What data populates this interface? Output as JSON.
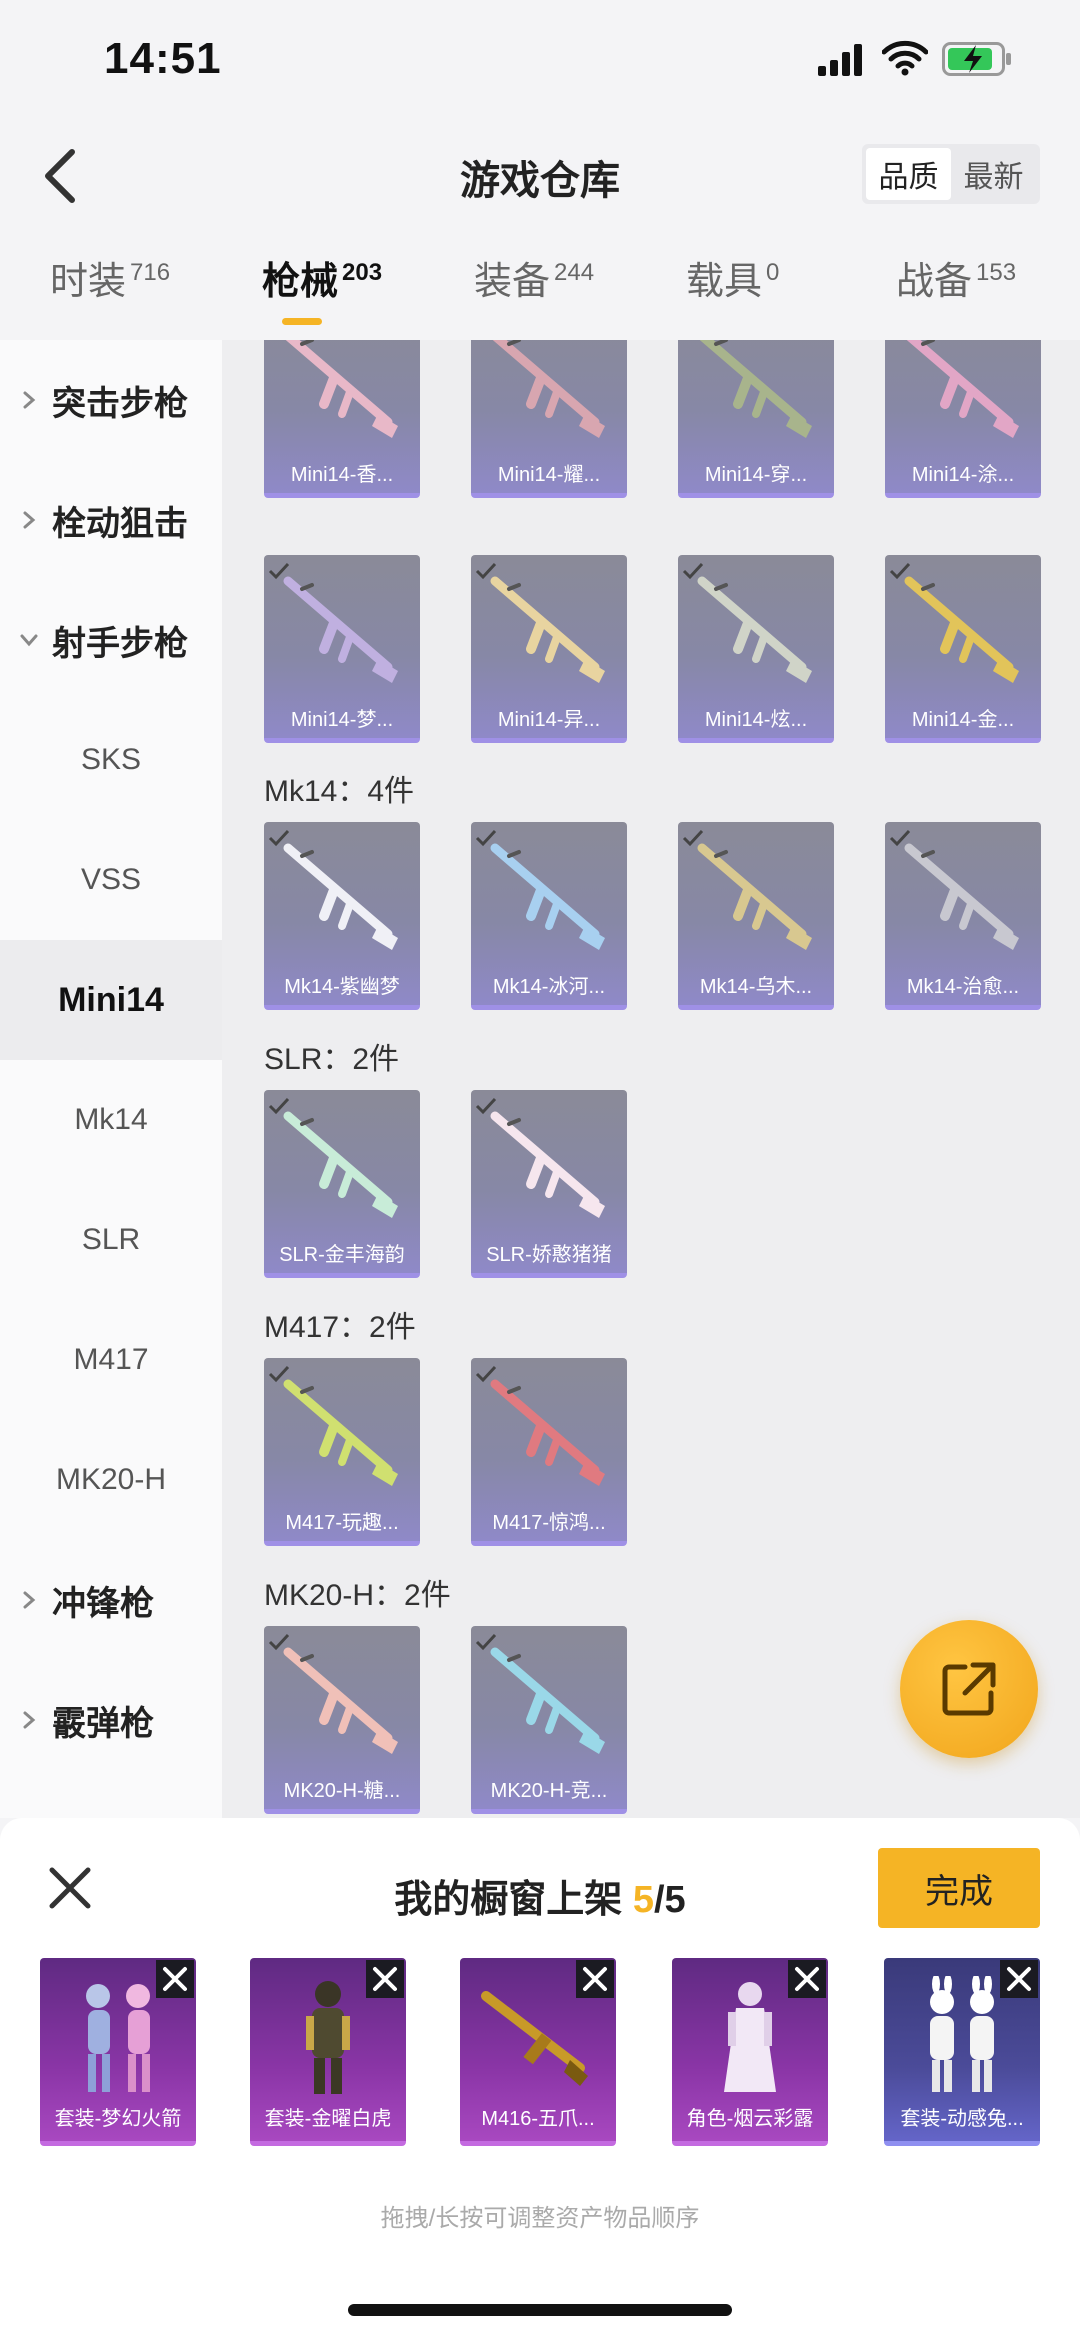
{
  "status": {
    "time": "14:51"
  },
  "header": {
    "title": "游戏仓库",
    "sort_options": [
      "品质",
      "最新"
    ]
  },
  "tabs": [
    {
      "label": "时装",
      "count": "716"
    },
    {
      "label": "枪械",
      "count": "203",
      "active": true
    },
    {
      "label": "装备",
      "count": "244"
    },
    {
      "label": "载具",
      "count": "0"
    },
    {
      "label": "战备",
      "count": "153"
    }
  ],
  "sidebar": {
    "items": [
      {
        "label": "突击步枪",
        "kind": "group"
      },
      {
        "label": "栓动狙击",
        "kind": "group"
      },
      {
        "label": "射手步枪",
        "kind": "group",
        "expanded": true
      },
      {
        "label": "SKS",
        "kind": "sub"
      },
      {
        "label": "VSS",
        "kind": "sub"
      },
      {
        "label": "Mini14",
        "kind": "sub",
        "selected": true
      },
      {
        "label": "Mk14",
        "kind": "sub"
      },
      {
        "label": "SLR",
        "kind": "sub"
      },
      {
        "label": "M417",
        "kind": "sub"
      },
      {
        "label": "MK20-H",
        "kind": "sub"
      },
      {
        "label": "冲锋枪",
        "kind": "group"
      },
      {
        "label": "霰弹枪",
        "kind": "group"
      }
    ]
  },
  "grid": {
    "top_row": [
      "Mini14-香...",
      "Mini14-耀...",
      "Mini14-穿...",
      "Mini14-涂..."
    ],
    "mini14_row": [
      "Mini14-梦...",
      "Mini14-异...",
      "Mini14-炫...",
      "Mini14-金..."
    ],
    "sections": [
      {
        "label": "Mk14：4件",
        "items": [
          "Mk14-紫幽梦",
          "Mk14-冰河...",
          "Mk14-乌木...",
          "Mk14-治愈..."
        ]
      },
      {
        "label": "SLR：2件",
        "items": [
          "SLR-金丰海韵",
          "SLR-娇憨猪猪"
        ]
      },
      {
        "label": "M417：2件",
        "items": [
          "M417-玩趣...",
          "M417-惊鸿..."
        ]
      },
      {
        "label": "MK20-H：2件",
        "items": [
          "MK20-H-糖...",
          "MK20-H-竞..."
        ]
      }
    ]
  },
  "panel": {
    "title_prefix": "我的橱窗上架 ",
    "count_current": "5",
    "count_total": "/5",
    "done_label": "完成",
    "items": [
      "套装-梦幻火箭",
      "套装-金曜白虎",
      "M416-五爪...",
      "角色-烟云彩露",
      "套装-动感兔..."
    ],
    "hint": "拖拽/长按可调整资产物品顺序"
  },
  "colors": {
    "accent": "#f5b425",
    "card_purple": "#9f90e6",
    "shelf_purple": "#a848c0"
  }
}
